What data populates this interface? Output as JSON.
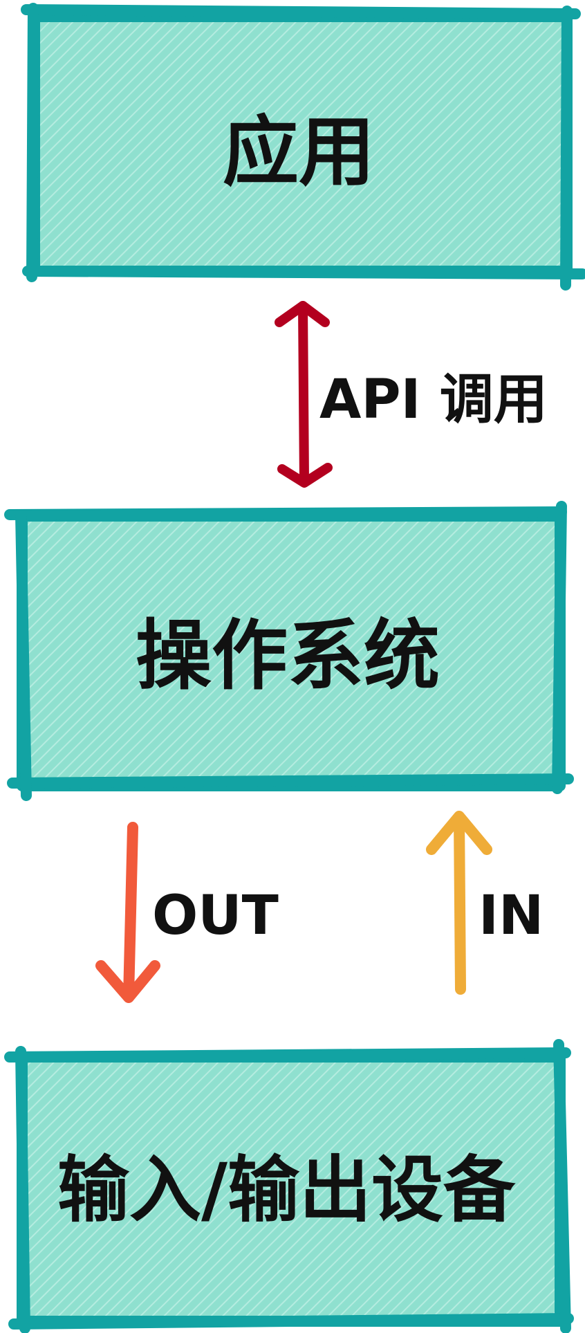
{
  "boxes": {
    "application": {
      "label": "应用"
    },
    "os": {
      "label": "操作系统"
    },
    "io_devices": {
      "label": "输入/输出设备"
    }
  },
  "edges": {
    "api_call": {
      "label": "API 调用"
    },
    "out": {
      "label": "OUT"
    },
    "in": {
      "label": "IN"
    }
  },
  "colors": {
    "box_border": "#12a3a3",
    "box_fill": "#8fe0cf",
    "box_hatch": "#b5ece0",
    "api_arrow": "#b3001f",
    "out_arrow": "#f15a3b",
    "in_arrow": "#efac38",
    "text": "#111111"
  }
}
